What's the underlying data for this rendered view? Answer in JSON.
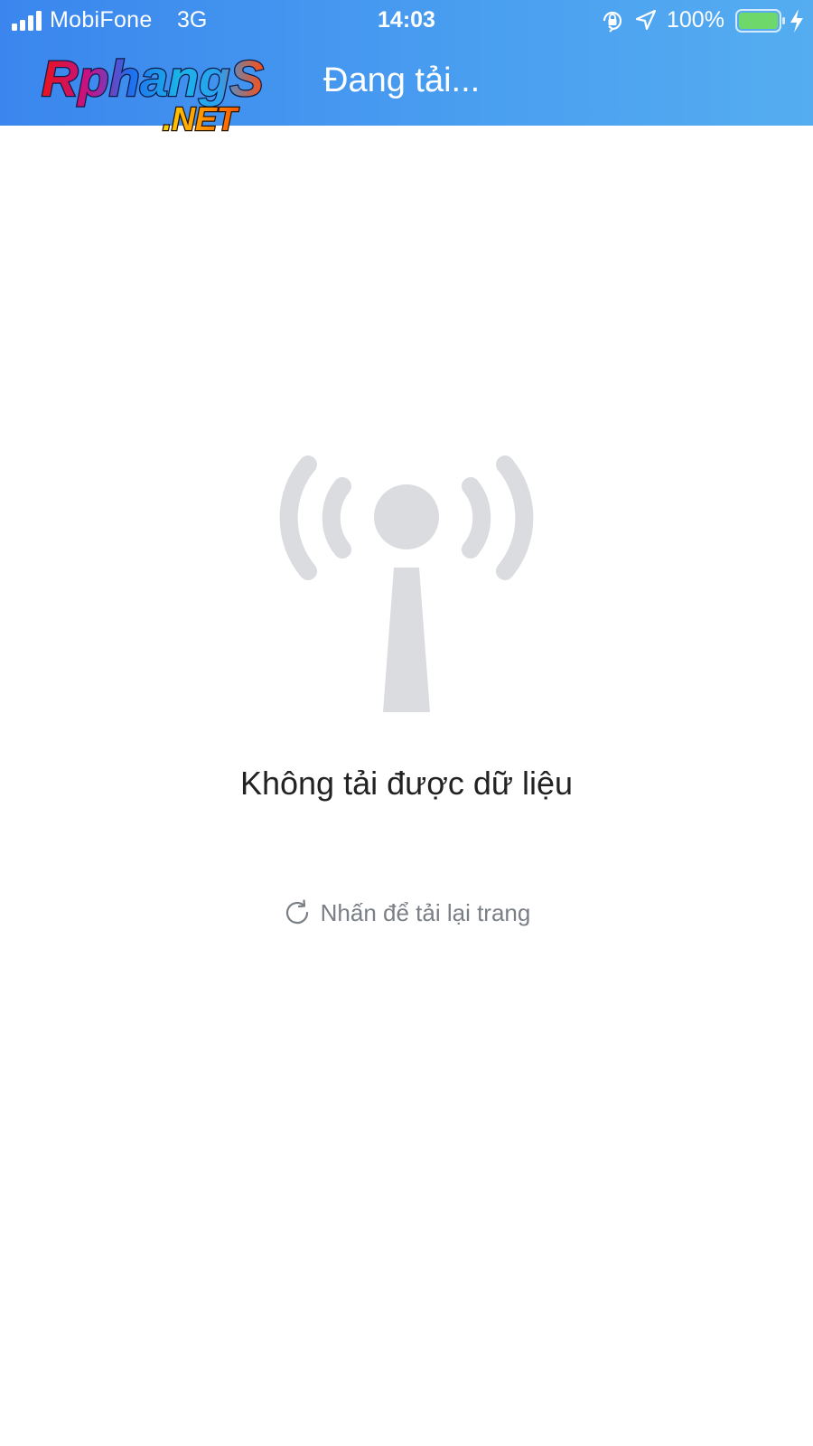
{
  "status_bar": {
    "carrier": "MobiFone",
    "network": "3G",
    "time": "14:03",
    "battery_percent_text": "100%",
    "battery_level": 1.0,
    "icons": [
      "signal-icon",
      "orientation-lock-icon",
      "location-arrow-icon",
      "battery-icon",
      "charging-bolt-icon"
    ]
  },
  "header": {
    "logo_text": "RphangS",
    "logo_subtext": ".NET",
    "title": "Đang tải..."
  },
  "content": {
    "icon": "broadcast-tower-icon",
    "error_message": "Không tải được dữ liệu",
    "reload_icon": "refresh-icon",
    "reload_label": "Nhấn để tải lại trang"
  },
  "colors": {
    "header_start": "#3a86ee",
    "header_end": "#55adf0",
    "icon_gray": "#dadcdf",
    "text_dark": "#222222",
    "text_muted": "#7a7e85",
    "battery_green": "#6fd86a"
  }
}
